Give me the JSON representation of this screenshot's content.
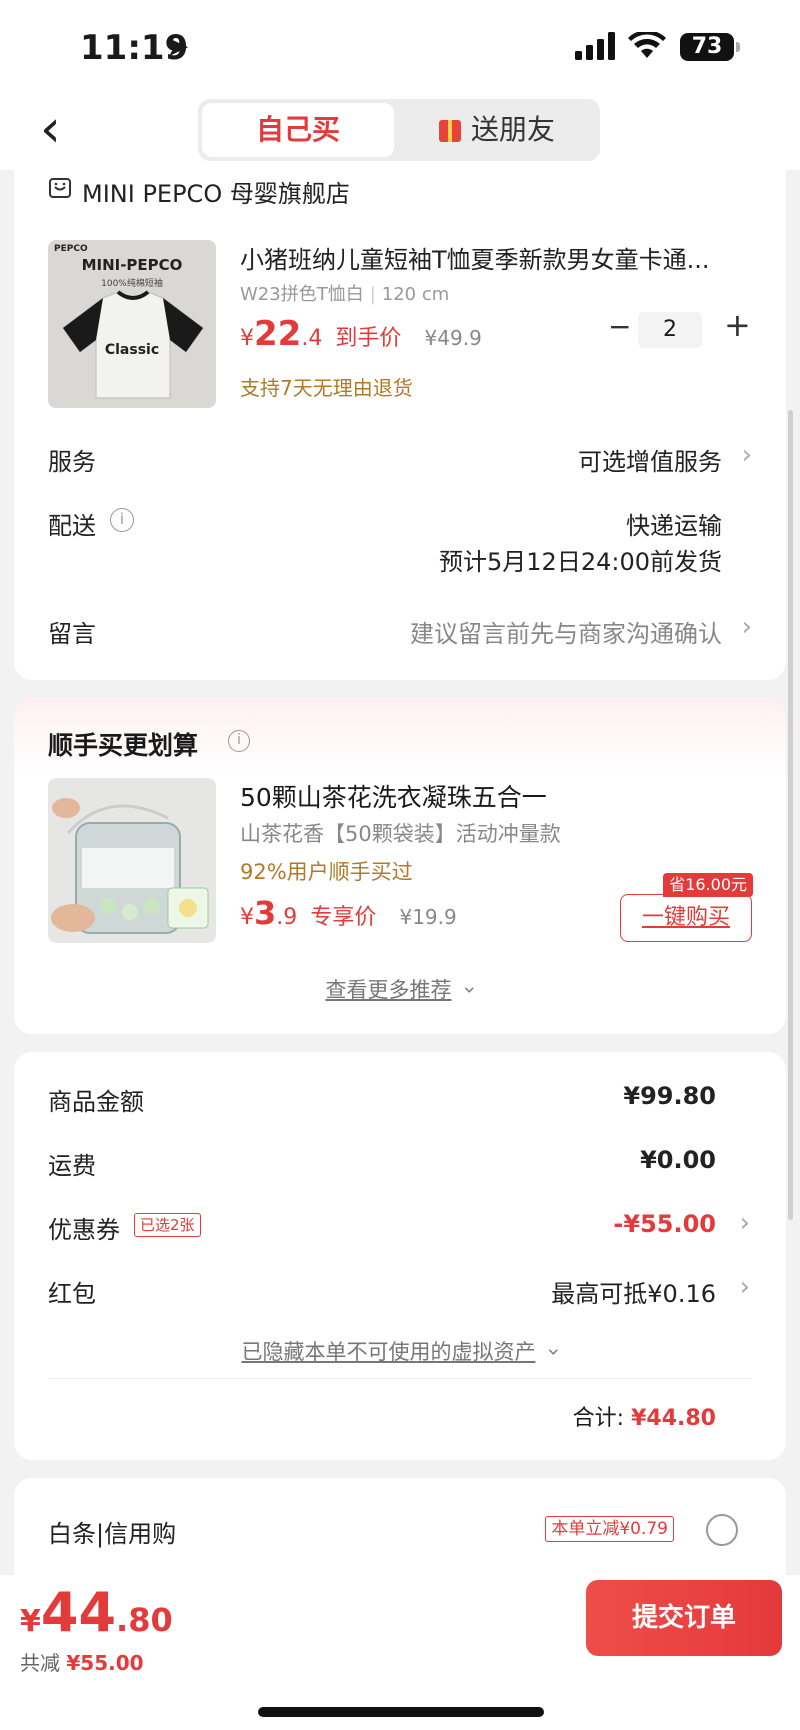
{
  "status": {
    "time": "11:19",
    "battery": "73"
  },
  "nav": {
    "tab_self": "自己买",
    "tab_gift": "送朋友"
  },
  "order": {
    "shop_name": "MINI PEPCO 母婴旗舰店",
    "product": {
      "title": "小猪班纳儿童短袖T恤夏季新款男女童卡通...",
      "spec": "W23拼色T恤白",
      "size": "120 cm",
      "price_symbol": "¥",
      "price_int": "22",
      "price_dec": ".4",
      "price_tag": "到手价",
      "orig_price": "¥49.9",
      "qty": "2",
      "minus": "−",
      "plus": "+",
      "return_policy": "支持7天无理由退货",
      "thumb_brand": "MINI-PEPCO",
      "thumb_sub": "100%纯棉短袖",
      "thumb_text": "Classic",
      "thumb_logo": "PEPCO"
    },
    "service_label": "服务",
    "service_value": "可选增值服务",
    "delivery_label": "配送",
    "delivery_method": "快递运输",
    "delivery_eta": "预计5月12日24:00前发货",
    "message_label": "留言",
    "message_placeholder": "建议留言前先与商家沟通确认"
  },
  "addon": {
    "title": "顺手买更划算",
    "product_title": "50颗山茶花洗衣凝珠五合一",
    "spec": "山茶花香【50颗袋装】活动冲量款",
    "social": "92%用户顺手买过",
    "price_symbol": "¥",
    "price_int": "3",
    "price_dec": ".9",
    "price_tag": "专享价",
    "orig_price": "¥19.9",
    "save_badge": "省16.00元",
    "buy_button": "一键购买",
    "more": "查看更多推荐"
  },
  "summary": {
    "goods_label": "商品金额",
    "goods_value": "¥99.80",
    "shipping_label": "运费",
    "shipping_value": "¥0.00",
    "coupon_label": "优惠券",
    "coupon_badge": "已选2张",
    "coupon_value": "-¥55.00",
    "redpacket_label": "红包",
    "redpacket_value": "最高可抵¥0.16",
    "hidden_assets": "已隐藏本单不可使用的虚拟资产",
    "total_label": "合计:",
    "total_value": "¥44.80"
  },
  "payment": {
    "label": "白条|信用购",
    "badge": "本单立减¥0.79"
  },
  "bottom": {
    "symbol": "¥",
    "amount_int": "44",
    "amount_dec": ".80",
    "discount_label": "共减",
    "discount_value": "¥55.00",
    "submit": "提交订单"
  },
  "colors": {
    "accent": "#e33b3b",
    "gold": "#b07a2a"
  }
}
